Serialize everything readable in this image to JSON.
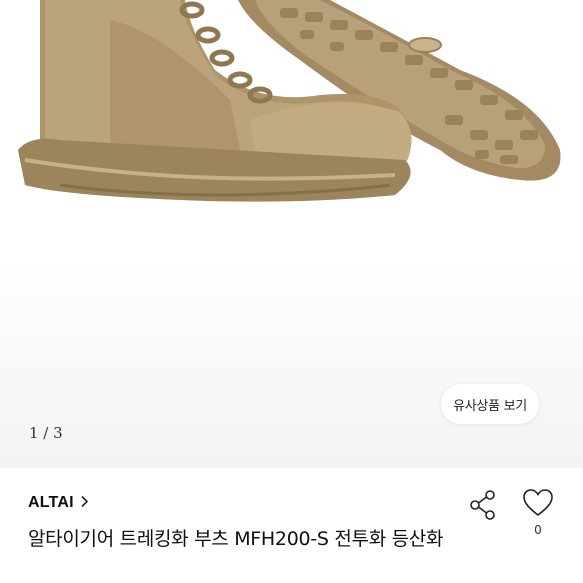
{
  "product_image": {
    "alt": "ALTAI 트레킹화 부츠 MFH200-S"
  },
  "pager": {
    "text": "1 / 3"
  },
  "similar_button": {
    "label": "유사상품 보기"
  },
  "brand": {
    "name": "ALTAI",
    "chevron": "›"
  },
  "product": {
    "title": "알타이기어 트레킹화 부츠 MFH200-S 전투화 등산화"
  },
  "like": {
    "count": "0"
  },
  "icons": {
    "share": "share-icon",
    "heart": "heart-icon",
    "chevron": "chevron-right-icon"
  },
  "colors": {
    "boot": "#b39a73",
    "sole": "#a68d66",
    "background": "#ffffff"
  }
}
